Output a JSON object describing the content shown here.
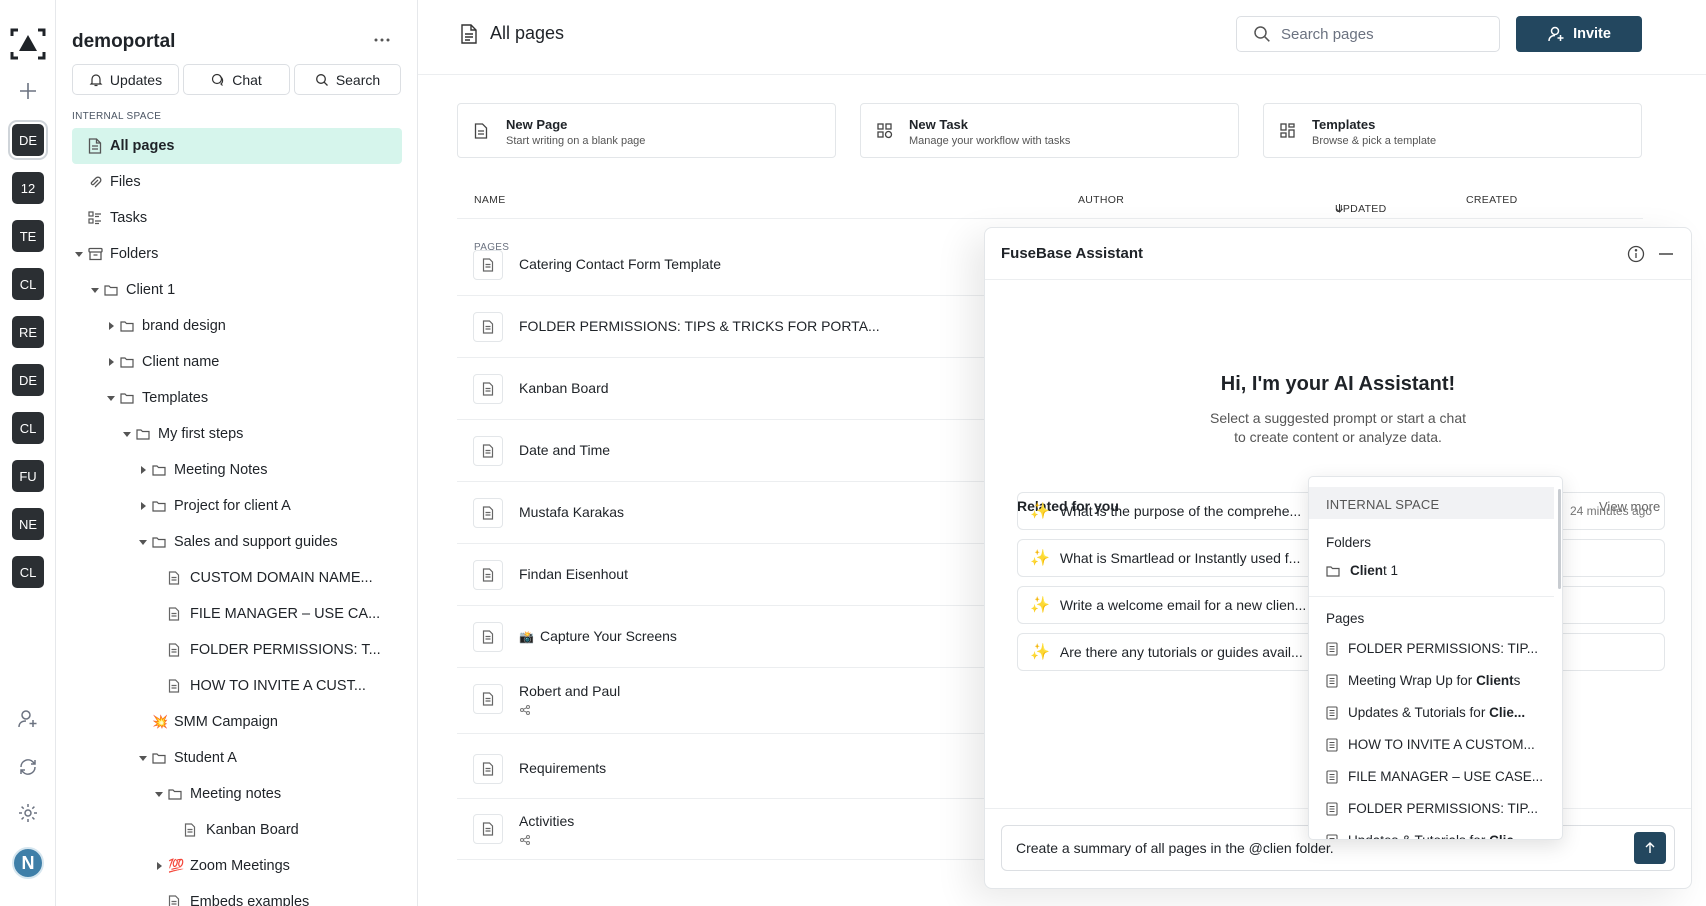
{
  "sidebar": {
    "title": "demoportal",
    "tabs": [
      {
        "label": "Updates",
        "icon": "bell-icon"
      },
      {
        "label": "Chat",
        "icon": "chat-icon"
      },
      {
        "label": "Search",
        "icon": "search-icon"
      }
    ],
    "section_label": "INTERNAL SPACE",
    "tree": [
      {
        "label": "All pages",
        "icon": "pages-icon",
        "depth": 0,
        "caret": "none",
        "selected": true
      },
      {
        "label": "Files",
        "icon": "paperclip-icon",
        "depth": 0,
        "caret": "none"
      },
      {
        "label": "Tasks",
        "icon": "tasks-icon",
        "depth": 0,
        "caret": "none"
      },
      {
        "label": "Folders",
        "icon": "archive-icon",
        "depth": 0,
        "caret": "down"
      },
      {
        "label": "Client 1",
        "icon": "folder-icon",
        "depth": 1,
        "caret": "down"
      },
      {
        "label": "brand design",
        "icon": "folder-icon",
        "depth": 2,
        "caret": "right"
      },
      {
        "label": "Client name",
        "icon": "folder-icon",
        "depth": 2,
        "caret": "right"
      },
      {
        "label": "Templates",
        "icon": "folder-icon",
        "depth": 2,
        "caret": "down"
      },
      {
        "label": "My first steps",
        "icon": "folder-icon",
        "depth": 3,
        "caret": "down"
      },
      {
        "label": "Meeting Notes",
        "icon": "folder-icon",
        "depth": 4,
        "caret": "right"
      },
      {
        "label": "Project for client A",
        "icon": "folder-icon",
        "depth": 4,
        "caret": "right"
      },
      {
        "label": "Sales and support guides",
        "icon": "folder-icon",
        "depth": 4,
        "caret": "down"
      },
      {
        "label": "CUSTOM DOMAIN NAME...",
        "icon": "page-icon",
        "depth": 5,
        "caret": "none"
      },
      {
        "label": "FILE MANAGER – USE CA...",
        "icon": "page-icon",
        "depth": 5,
        "caret": "none"
      },
      {
        "label": "FOLDER PERMISSIONS: T...",
        "icon": "page-icon",
        "depth": 5,
        "caret": "none"
      },
      {
        "label": "HOW TO INVITE A CUST...",
        "icon": "page-icon",
        "depth": 5,
        "caret": "none"
      },
      {
        "label": "SMM Campaign",
        "icon": "burst-emoji",
        "emoji": "💥",
        "depth": 4,
        "caret": "none"
      },
      {
        "label": "Student A",
        "icon": "folder-icon",
        "depth": 4,
        "caret": "down"
      },
      {
        "label": "Meeting notes",
        "icon": "folder-icon",
        "depth": 5,
        "caret": "down"
      },
      {
        "label": "Kanban Board",
        "icon": "page-icon",
        "depth": 6,
        "caret": "none"
      },
      {
        "label": "Zoom Meetings",
        "icon": "hundred-emoji",
        "emoji": "💯",
        "depth": 5,
        "caret": "right"
      },
      {
        "label": "Embeds examples",
        "icon": "page-icon",
        "depth": 5,
        "caret": "none"
      }
    ]
  },
  "rail": {
    "workspaces": [
      "DE",
      "12",
      "TE",
      "CL",
      "RE",
      "DE",
      "CL",
      "FU",
      "NE",
      "CL"
    ],
    "avatar_initial": "N"
  },
  "header": {
    "title": "All pages",
    "search_placeholder": "Search pages",
    "invite_label": "Invite"
  },
  "cards": [
    {
      "title": "New Page",
      "subtitle": "Start writing on a blank page",
      "icon": "page-icon"
    },
    {
      "title": "New Task",
      "subtitle": "Manage your workflow with tasks",
      "icon": "task-icon"
    },
    {
      "title": "Templates",
      "subtitle": "Browse & pick a template",
      "icon": "template-icon"
    }
  ],
  "table": {
    "columns": {
      "name": "NAME",
      "author": "AUTHOR",
      "updated": "UPDATED",
      "created": "CREATED"
    },
    "section_label": "PAGES",
    "rows": [
      {
        "name": "Catering Contact Form Template"
      },
      {
        "name": "FOLDER PERMISSIONS: TIPS & TRICKS FOR PORTA..."
      },
      {
        "name": "Kanban Board"
      },
      {
        "name": "Date and Time"
      },
      {
        "name": "Mustafa Karakas"
      },
      {
        "name": "Findan Eisenhout"
      },
      {
        "name": "Capture Your Screens",
        "emoji": "📸"
      },
      {
        "name": "Robert and Paul",
        "shared": true
      },
      {
        "name": "Requirements"
      },
      {
        "name": "Activities",
        "shared": true
      }
    ]
  },
  "assistant": {
    "title": "FuseBase Assistant",
    "greeting": "Hi, I'm your AI Assistant!",
    "sub_line1": "Select a suggested prompt or start a chat",
    "sub_line2": "to create content or analyze data.",
    "related_label": "Related for you",
    "view_more": "View more",
    "prompts": [
      {
        "text": "What is the purpose of the comprehe...",
        "ago": "24 minutes ago"
      },
      {
        "text": "What is Smartlead or Instantly used f..."
      },
      {
        "text": "Write a welcome email for a new clien..."
      },
      {
        "text": "Are there any tutorials or guides avail..."
      }
    ],
    "input_value": "Create a summary of all pages in the @clien folder."
  },
  "mention_dropdown": {
    "header": "INTERNAL SPACE",
    "folders_label": "Folders",
    "folders": [
      {
        "pre": "",
        "match": "Clien",
        "post": "t 1"
      }
    ],
    "pages_label": "Pages",
    "pages": [
      {
        "pre": "FOLDER PERMISSIONS: TIP...",
        "match": "",
        "post": ""
      },
      {
        "pre": "Meeting Wrap Up for ",
        "match": "Client",
        "post": "s"
      },
      {
        "pre": "Updates & Tutorials for ",
        "match": "Clie...",
        "post": ""
      },
      {
        "pre": "HOW TO INVITE A CUSTOM...",
        "match": "",
        "post": ""
      },
      {
        "pre": "FILE MANAGER – USE CASE...",
        "match": "",
        "post": ""
      },
      {
        "pre": "FOLDER PERMISSIONS: TIP...",
        "match": "",
        "post": ""
      },
      {
        "pre": "Updates & Tutorials for ",
        "match": "Clie...",
        "post": ""
      }
    ]
  }
}
